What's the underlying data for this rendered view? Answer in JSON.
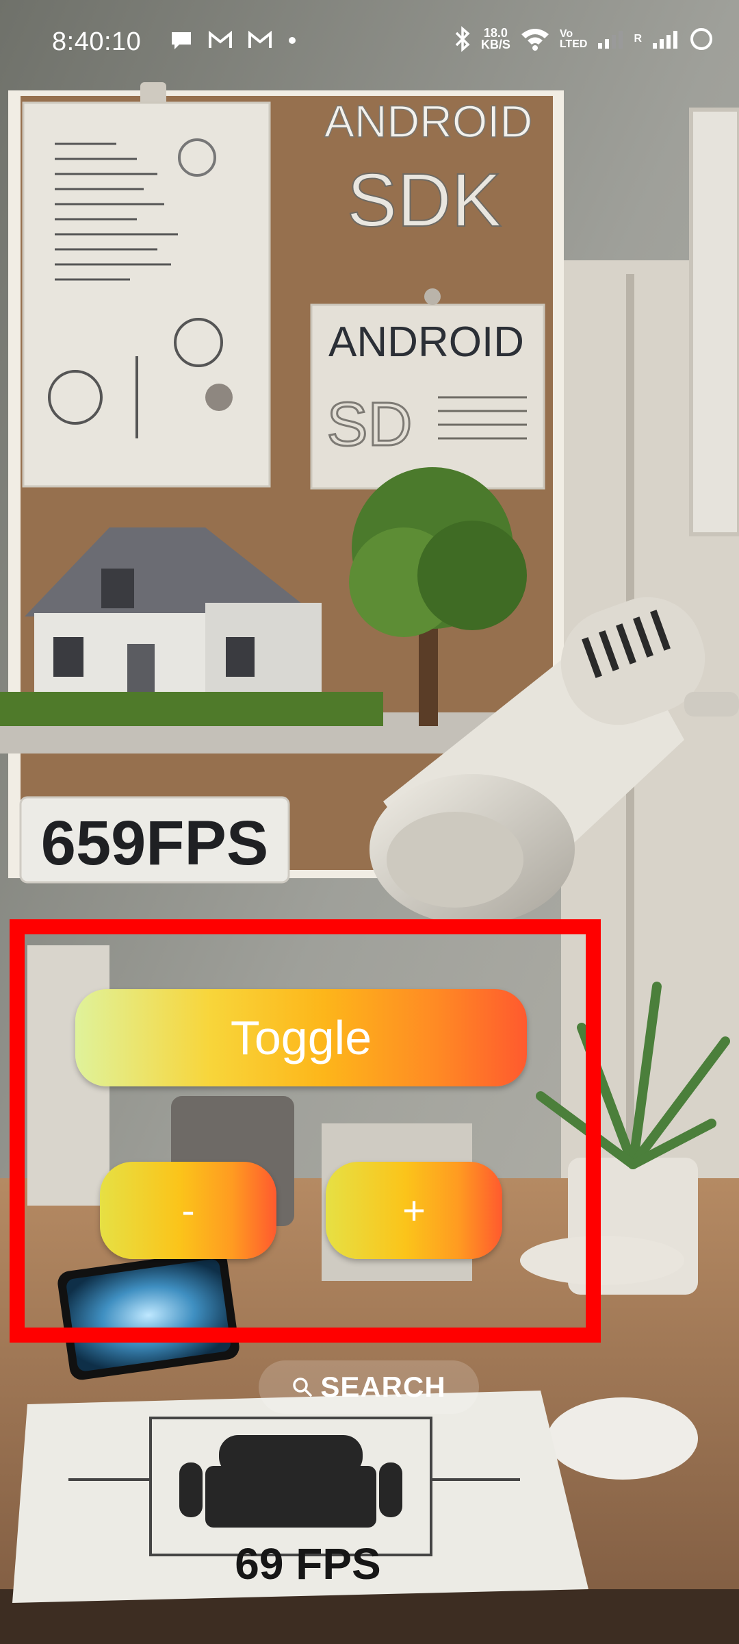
{
  "status_bar": {
    "time": "8:40:10",
    "notification_icons": [
      "chat-bubble-icon",
      "gmail-icon",
      "gmail-icon",
      "dot-icon"
    ],
    "net_speed_value": "18.0",
    "net_speed_unit": "KB/S",
    "volte_top": "Vo",
    "volte_bottom": "LTED",
    "roaming_label": "R"
  },
  "background": {
    "board_title_top": "ANDROID",
    "board_title_bottom": "SDK",
    "poster_line1": "ANDROID",
    "poster_line2": "SD",
    "fps_sign": "659FPS",
    "paper_fps": "69 FPS"
  },
  "controls": {
    "toggle_label": "Toggle",
    "minus_label": "-",
    "plus_label": "+"
  },
  "search": {
    "label": "SEARCH"
  },
  "colors": {
    "highlight": "#ff0000",
    "button_gradient_start": "#dff29b",
    "button_gradient_mid": "#fdb61a",
    "button_gradient_end": "#ff5a2e"
  }
}
